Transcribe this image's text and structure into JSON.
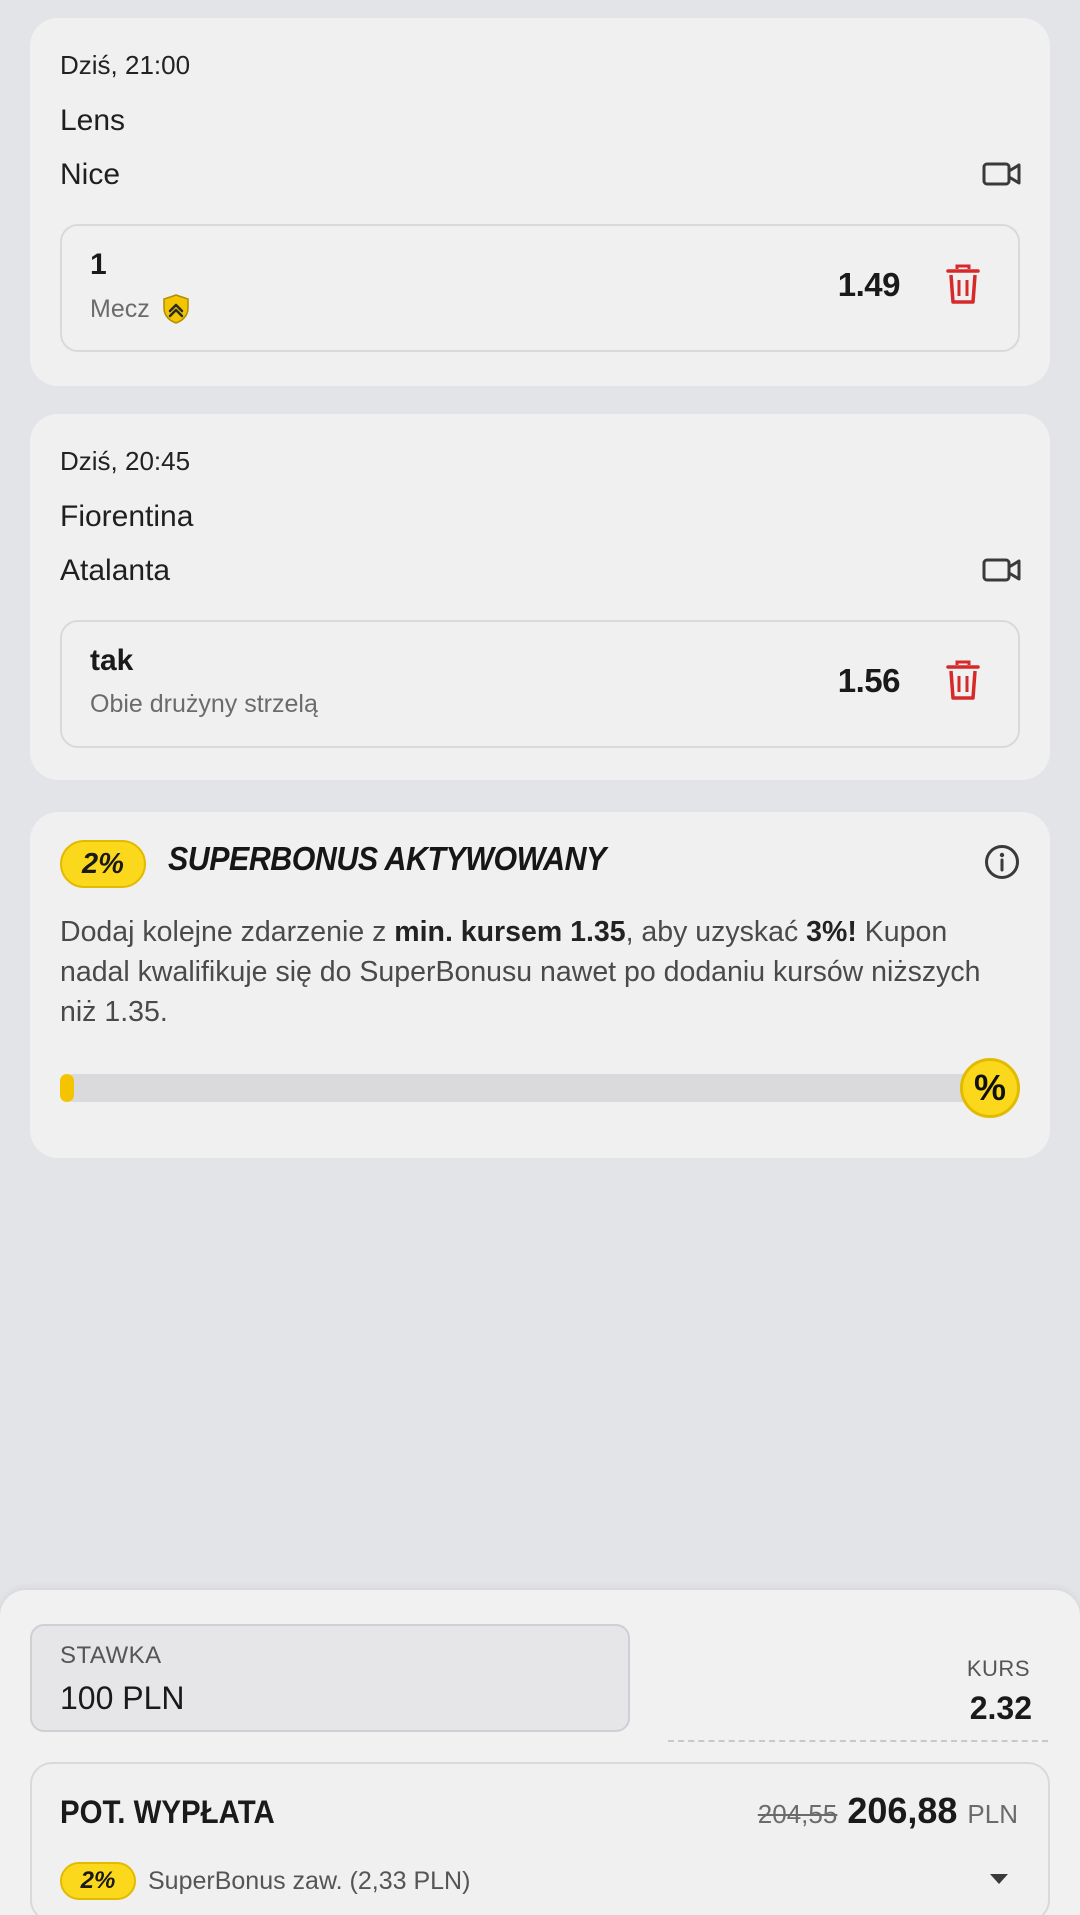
{
  "events": [
    {
      "time": "Dziś, 21:00",
      "team1": "Lens",
      "team2": "Nice",
      "selection": "1",
      "market": "Mecz",
      "odds": "1.49"
    },
    {
      "time": "Dziś, 20:45",
      "team1": "Fiorentina",
      "team2": "Atalanta",
      "selection": "tak",
      "market": "Obie drużyny strzelą",
      "odds": "1.56"
    }
  ],
  "superbonus": {
    "percent": "2%",
    "title": "SUPERBONUS AKTYWOWANY",
    "text_1": "Dodaj kolejne zdarzenie z ",
    "text_bold_1": "min. kursem 1.35",
    "text_2": ", aby uzyskać ",
    "text_bold_2": "3%!",
    "text_3": " Kupon nadal kwalifikuje się do SuperBonusu nawet po dodaniu kursów niższych niż 1.35.",
    "progress": 0.015,
    "badge": "%"
  },
  "betslip": {
    "stake_label": "STAWKA",
    "stake_value": "100 PLN",
    "odds_label": "KURS",
    "odds_value": "2.32",
    "payout_label": "POT. WYPŁATA",
    "payout_old": "204,55",
    "payout_new": "206,88",
    "currency": "PLN",
    "bonus_percent": "2%",
    "bonus_text": "SuperBonus zaw. (2,33 PLN)"
  },
  "colors": {
    "accent_yellow": "#fcd81d",
    "delete_red": "#d62a2a",
    "background": "#e3e4e8",
    "card": "#f0f0f1"
  },
  "icons": [
    "video-icon",
    "trash-icon",
    "shield-boost-icon",
    "info-icon",
    "percent-badge",
    "chevron-down-icon"
  ]
}
